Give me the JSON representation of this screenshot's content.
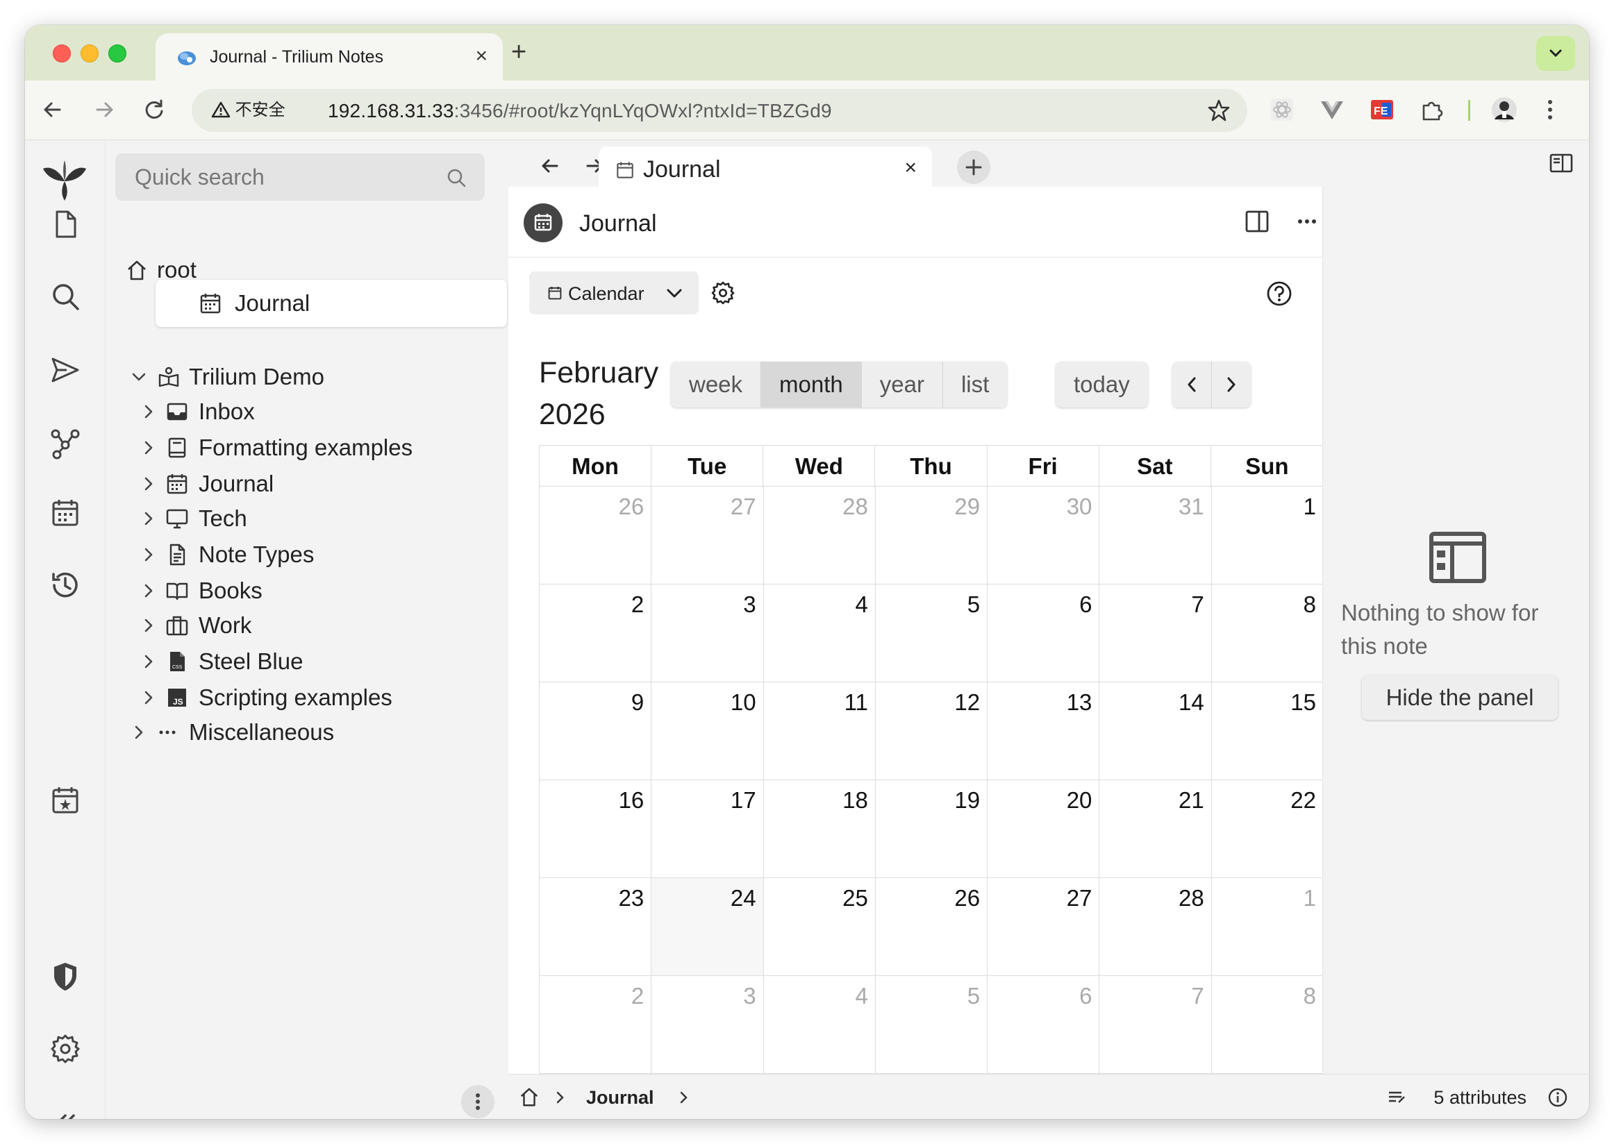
{
  "browser": {
    "tab_title": "Journal - Trilium Notes",
    "close_glyph": "×",
    "new_tab_glyph": "+",
    "insecure_label": "不安全",
    "url_host": "192.168.31.33",
    "url_path": ":3456/#root/kzYqnLYqOWxl?ntxId=TBZGd9"
  },
  "search": {
    "placeholder": "Quick search"
  },
  "tree": {
    "root_label": "root",
    "journal_active": "Journal",
    "demo_label": "Trilium Demo",
    "children": [
      {
        "label": "Inbox",
        "icon": "inbox-icon"
      },
      {
        "label": "Formatting examples",
        "icon": "book-icon"
      },
      {
        "label": "Journal",
        "icon": "calendar-icon"
      },
      {
        "label": "Tech",
        "icon": "monitor-icon"
      },
      {
        "label": "Note Types",
        "icon": "file-icon"
      },
      {
        "label": "Books",
        "icon": "open-book-icon"
      },
      {
        "label": "Work",
        "icon": "briefcase-icon"
      },
      {
        "label": "Steel Blue",
        "icon": "css-file-icon"
      },
      {
        "label": "Scripting examples",
        "icon": "js-file-icon"
      }
    ],
    "misc_label": "Miscellaneous"
  },
  "note_tab": {
    "label": "Journal",
    "close_glyph": "×"
  },
  "note": {
    "title": "Journal",
    "view_type": "Calendar"
  },
  "calendar": {
    "title_month": "February",
    "title_year": "2026",
    "views": [
      "week",
      "month",
      "year",
      "list"
    ],
    "active_view": "month",
    "today_label": "today",
    "weekdays": [
      "Mon",
      "Tue",
      "Wed",
      "Thu",
      "Fri",
      "Sat",
      "Sun"
    ],
    "weeks": [
      [
        {
          "d": "26",
          "o": true
        },
        {
          "d": "27",
          "o": true
        },
        {
          "d": "28",
          "o": true
        },
        {
          "d": "29",
          "o": true
        },
        {
          "d": "30",
          "o": true
        },
        {
          "d": "31",
          "o": true
        },
        {
          "d": "1",
          "o": false
        }
      ],
      [
        {
          "d": "2",
          "o": false
        },
        {
          "d": "3",
          "o": false
        },
        {
          "d": "4",
          "o": false
        },
        {
          "d": "5",
          "o": false
        },
        {
          "d": "6",
          "o": false
        },
        {
          "d": "7",
          "o": false
        },
        {
          "d": "8",
          "o": false
        }
      ],
      [
        {
          "d": "9",
          "o": false
        },
        {
          "d": "10",
          "o": false
        },
        {
          "d": "11",
          "o": false
        },
        {
          "d": "12",
          "o": false
        },
        {
          "d": "13",
          "o": false
        },
        {
          "d": "14",
          "o": false
        },
        {
          "d": "15",
          "o": false
        }
      ],
      [
        {
          "d": "16",
          "o": false
        },
        {
          "d": "17",
          "o": false
        },
        {
          "d": "18",
          "o": false
        },
        {
          "d": "19",
          "o": false
        },
        {
          "d": "20",
          "o": false
        },
        {
          "d": "21",
          "o": false
        },
        {
          "d": "22",
          "o": false
        }
      ],
      [
        {
          "d": "23",
          "o": false
        },
        {
          "d": "24",
          "o": false,
          "today": true
        },
        {
          "d": "25",
          "o": false
        },
        {
          "d": "26",
          "o": false
        },
        {
          "d": "27",
          "o": false
        },
        {
          "d": "28",
          "o": false
        },
        {
          "d": "1",
          "o": true
        }
      ],
      [
        {
          "d": "2",
          "o": true
        },
        {
          "d": "3",
          "o": true
        },
        {
          "d": "4",
          "o": true
        },
        {
          "d": "5",
          "o": true
        },
        {
          "d": "6",
          "o": true
        },
        {
          "d": "7",
          "o": true
        },
        {
          "d": "8",
          "o": true
        }
      ]
    ]
  },
  "side_panel": {
    "message": "Nothing to show for this note",
    "hide_label": "Hide the panel"
  },
  "status": {
    "crumb": "Journal",
    "attributes": "5 attributes"
  },
  "colors": {
    "tabstrip": "#dfe8cf",
    "other_month": "#aaaaaa"
  }
}
